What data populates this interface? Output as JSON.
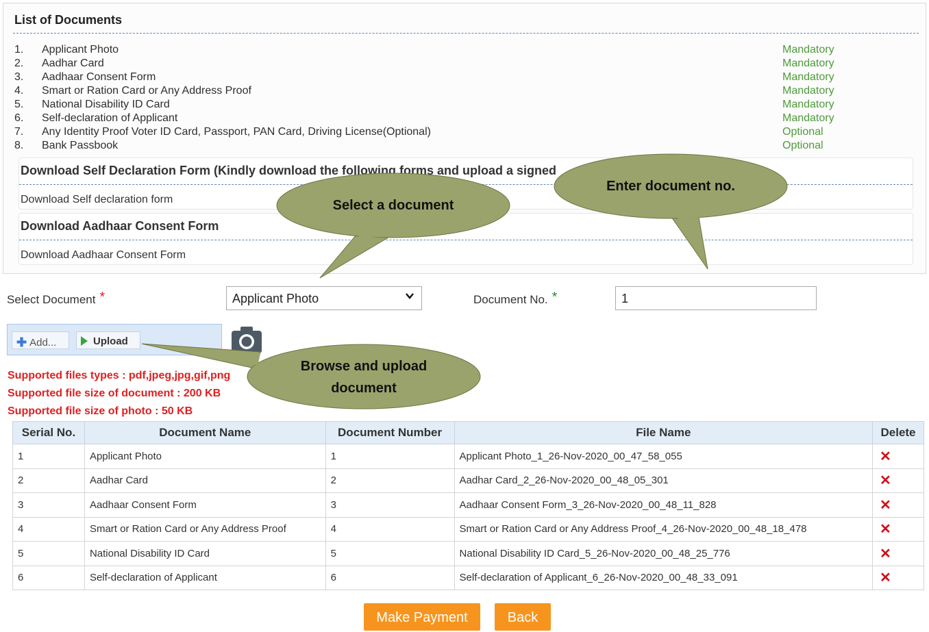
{
  "documents_panel": {
    "title": "List of Documents",
    "items": [
      {
        "num": "1.",
        "name": "Applicant Photo",
        "requirement": "Mandatory"
      },
      {
        "num": "2.",
        "name": "Aadhar Card",
        "requirement": "Mandatory"
      },
      {
        "num": "3.",
        "name": "Aadhaar Consent Form",
        "requirement": "Mandatory"
      },
      {
        "num": "4.",
        "name": "Smart or Ration Card or Any Address Proof",
        "requirement": "Mandatory"
      },
      {
        "num": "5.",
        "name": "National Disability ID Card",
        "requirement": "Mandatory"
      },
      {
        "num": "6.",
        "name": "Self-declaration of Applicant",
        "requirement": "Mandatory"
      },
      {
        "num": "7.",
        "name": "Any Identity Proof Voter ID Card, Passport, PAN Card, Driving License(Optional)",
        "requirement": "Optional"
      },
      {
        "num": "8.",
        "name": "Bank Passbook",
        "requirement": "Optional"
      }
    ],
    "self_declaration": {
      "title": "Download Self Declaration Form (Kindly download the following forms and upload a signed",
      "link": "Download Self declaration form"
    },
    "aadhaar_consent": {
      "title": "Download Aadhaar Consent Form",
      "link": "Download Aadhaar Consent Form"
    }
  },
  "form": {
    "select_document_label": "Select Document",
    "select_document_value": "Applicant Photo",
    "document_no_label": "Document No.",
    "document_no_value": "1",
    "required_mark": "*",
    "add_label": "Add...",
    "upload_label": "Upload"
  },
  "notes": {
    "file_types": "Supported files types : pdf,jpeg,jpg,gif,png",
    "doc_size": "Supported file size of document : 200 KB",
    "photo_size": "Supported file size of photo : 50 KB"
  },
  "table": {
    "headers": [
      "Serial No.",
      "Document Name",
      "Document Number",
      "File Name",
      "Delete"
    ],
    "rows": [
      {
        "serial": "1",
        "name": "Applicant Photo",
        "number": "1",
        "file": "Applicant Photo_1_26-Nov-2020_00_47_58_055"
      },
      {
        "serial": "2",
        "name": "Aadhar Card",
        "number": "2",
        "file": "Aadhar Card_2_26-Nov-2020_00_48_05_301"
      },
      {
        "serial": "3",
        "name": "Aadhaar Consent Form",
        "number": "3",
        "file": "Aadhaar Consent Form_3_26-Nov-2020_00_48_11_828"
      },
      {
        "serial": "4",
        "name": "Smart or Ration Card or Any Address Proof",
        "number": "4",
        "file": "Smart or Ration Card or Any Address Proof_4_26-Nov-2020_00_48_18_478"
      },
      {
        "serial": "5",
        "name": "National Disability ID Card",
        "number": "5",
        "file": "National Disability ID Card_5_26-Nov-2020_00_48_25_776"
      },
      {
        "serial": "6",
        "name": "Self-declaration of Applicant",
        "number": "6",
        "file": "Self-declaration of Applicant_6_26-Nov-2020_00_48_33_091"
      }
    ],
    "delete_glyph": "✕"
  },
  "actions": {
    "make_payment": "Make Payment",
    "back": "Back"
  },
  "callouts": {
    "enter_doc_no": "Enter document no.",
    "select_doc": "Select a document",
    "browse_upload_line1": "Browse and upload",
    "browse_upload_line2": "document"
  },
  "colors": {
    "mandatory": "#4f9a3a",
    "note_red": "#e02020",
    "button_orange": "#f7941d",
    "callout_fill": "#9ba36c"
  },
  "icons": {
    "dropdown": "chevron-down-icon",
    "add": "plus-icon",
    "upload": "play-arrow-icon",
    "camera": "camera-icon",
    "delete": "close-icon"
  }
}
